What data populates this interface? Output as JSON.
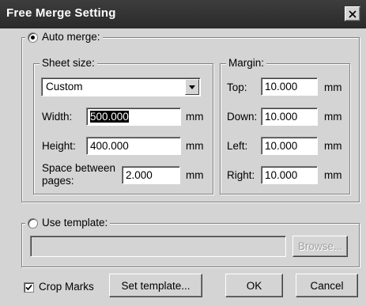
{
  "window": {
    "title": "Free Merge Setting"
  },
  "auto_merge": {
    "label": "Auto merge:",
    "selected": true,
    "sheet_size": {
      "label": "Sheet size:",
      "preset": "Custom",
      "width_label": "Width:",
      "width_value": "500.000",
      "height_label": "Height:",
      "height_value": "400.000",
      "space_label_line1": "Space between",
      "space_label_line2": "pages:",
      "space_value": "2.000",
      "unit": "mm"
    },
    "margin": {
      "label": "Margin:",
      "top_label": "Top:",
      "top_value": "10.000",
      "down_label": "Down:",
      "down_value": "10.000",
      "left_label": "Left:",
      "left_value": "10.000",
      "right_label": "Right:",
      "right_value": "10.000",
      "unit": "mm"
    }
  },
  "use_template": {
    "label": "Use template:",
    "selected": false,
    "path_value": "",
    "browse_label": "Browse..."
  },
  "footer": {
    "crop_marks_label": "Crop Marks",
    "crop_marks_checked": true,
    "set_template_label": "Set template...",
    "ok_label": "OK",
    "cancel_label": "Cancel"
  }
}
